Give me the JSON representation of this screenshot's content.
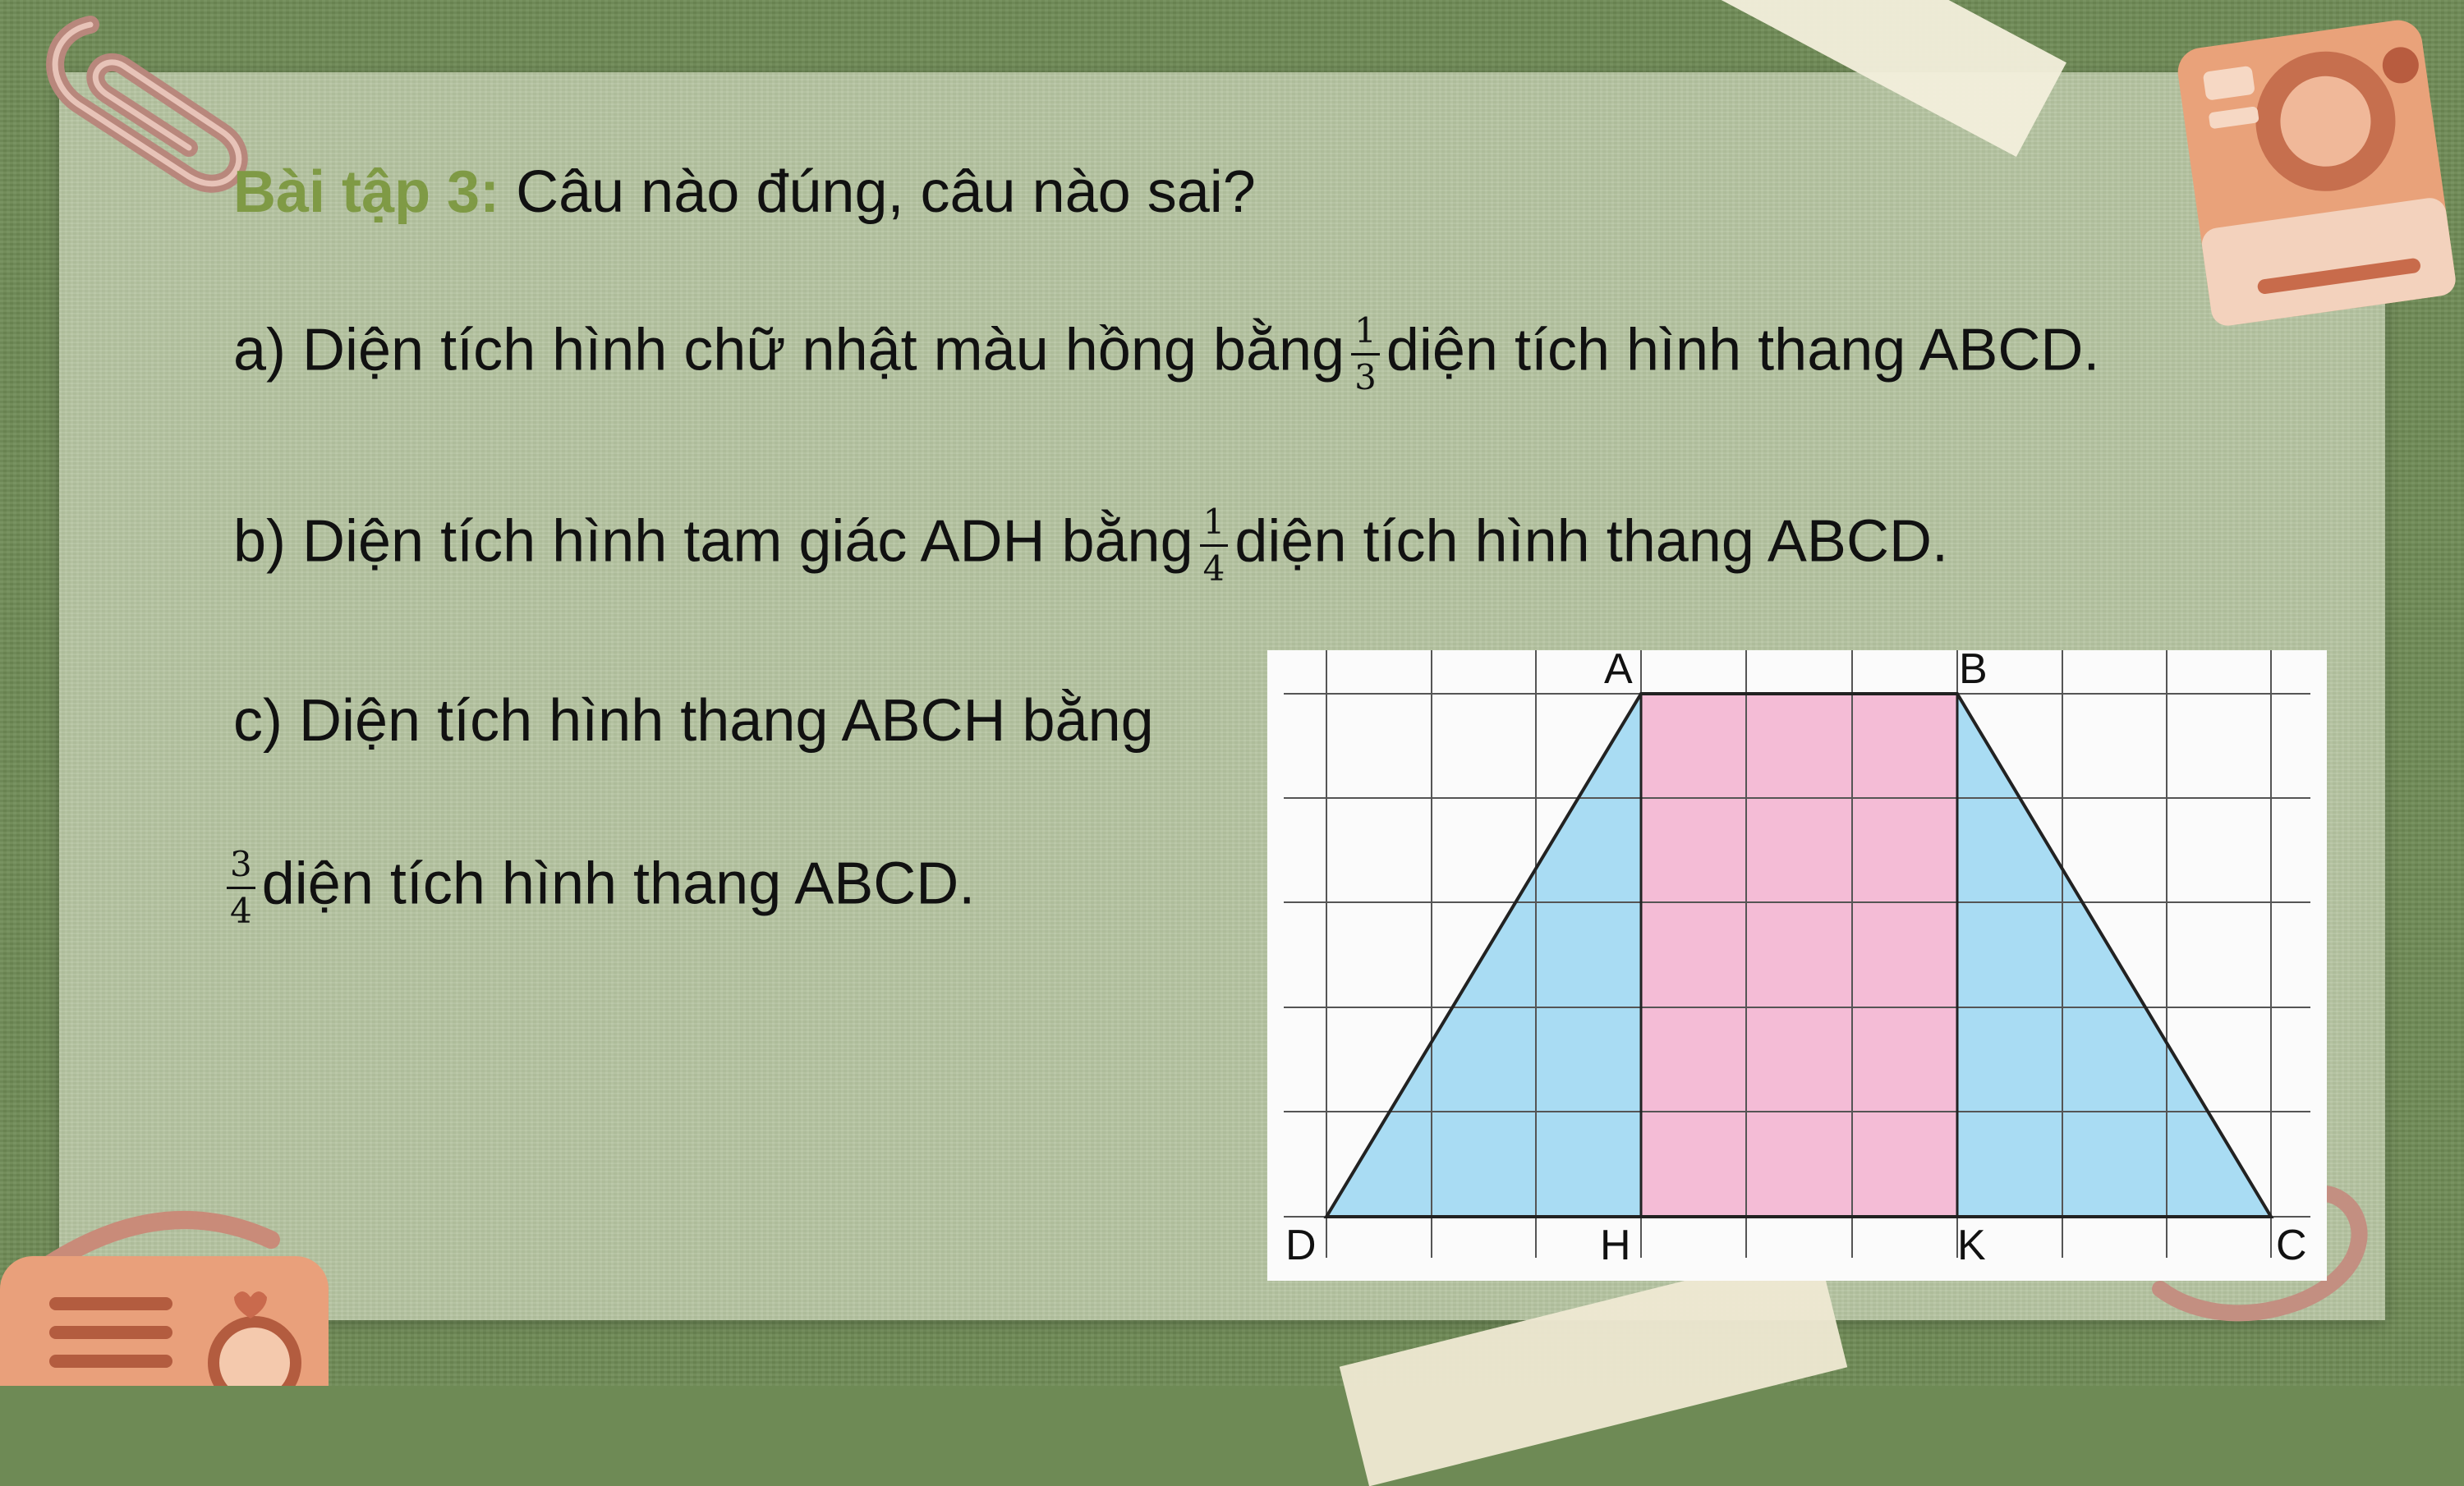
{
  "exercise": {
    "title_lead": "Bài tập 3:",
    "title_rest": "Câu nào đúng, câu nào sai?"
  },
  "statements": {
    "a": {
      "before": "a) Diện tích hình chữ nhật màu hồng bằng",
      "frac_num": "1",
      "frac_den": "3",
      "after": "diện tích hình thang ABCD."
    },
    "b": {
      "before": "b) Diện tích hình tam giác ADH bằng",
      "frac_num": "1",
      "frac_den": "4",
      "after": "diện tích hình thang ABCD."
    },
    "c": {
      "line1": "c) Diện tích hình thang ABCH bằng",
      "frac_num": "3",
      "frac_den": "4",
      "after": "diện tích hình thang ABCD."
    }
  },
  "figure": {
    "points": {
      "A": "A",
      "B": "B",
      "C": "C",
      "D": "D",
      "H": "H",
      "K": "K"
    },
    "colors": {
      "triangle_fill": "#a9dcf3",
      "rectangle_fill": "#f4bcd6",
      "grid": "#444444"
    }
  }
}
